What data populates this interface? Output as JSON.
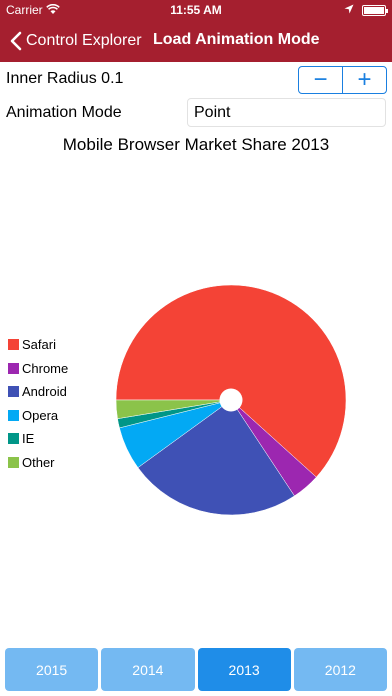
{
  "status": {
    "carrier": "Carrier",
    "time": "11:55 AM"
  },
  "nav": {
    "back_label": "Control Explorer",
    "title": "Load Animation Mode"
  },
  "controls": {
    "inner_radius_label": "Inner Radius 0.1",
    "stepper_minus": "−",
    "stepper_plus": "+",
    "animation_mode_label": "Animation Mode",
    "animation_mode_value": "Point"
  },
  "chart_data": {
    "type": "pie",
    "title": "Mobile Browser Market Share 2013",
    "inner_radius": 0.1,
    "start_angle_deg": 180,
    "legend_position": "left",
    "slices": [
      {
        "label": "Safari",
        "value": 61.7,
        "color": "#f44336"
      },
      {
        "label": "Chrome",
        "value": 4.0,
        "color": "#9c27b0"
      },
      {
        "label": "Android",
        "value": 24.3,
        "color": "#3f51b5"
      },
      {
        "label": "Opera",
        "value": 6.1,
        "color": "#03a9f4"
      },
      {
        "label": "IE",
        "value": 1.3,
        "color": "#009688"
      },
      {
        "label": "Other",
        "value": 2.6,
        "color": "#8bc34a"
      }
    ]
  },
  "years": [
    {
      "label": "2015",
      "selected": false
    },
    {
      "label": "2014",
      "selected": false
    },
    {
      "label": "2013",
      "selected": true
    },
    {
      "label": "2012",
      "selected": false
    }
  ]
}
